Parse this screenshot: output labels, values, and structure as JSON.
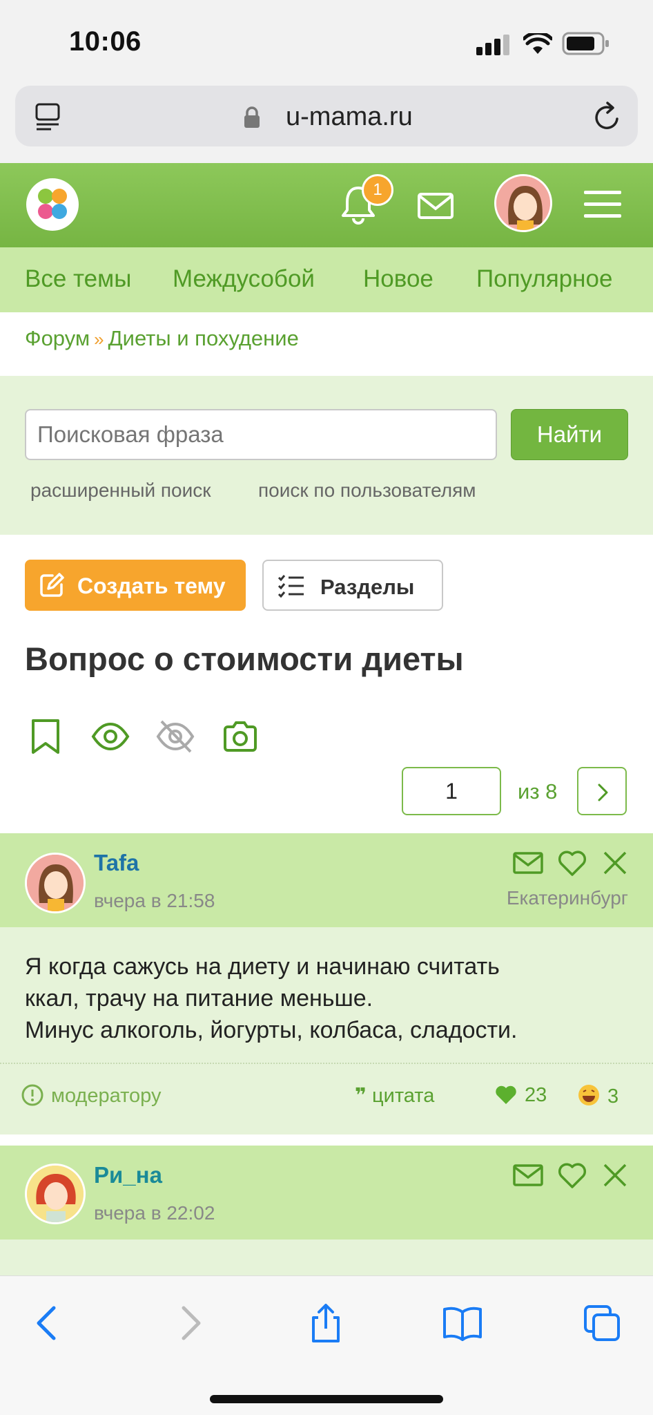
{
  "status": {
    "time": "10:06"
  },
  "browser": {
    "url": "u-mama.ru"
  },
  "header": {
    "notification_count": "1"
  },
  "nav": {
    "items": [
      "Все темы",
      "Междусобой",
      "Новое",
      "Популярное"
    ]
  },
  "breadcrumb": {
    "forum": "Форум",
    "section": "Диеты и похудение",
    "separator": "»"
  },
  "search": {
    "placeholder": "Поисковая фраза",
    "button": "Найти",
    "advanced": "расширенный поиск",
    "by_users": "поиск по пользователям"
  },
  "actions": {
    "create": "Создать тему",
    "sections": "Разделы"
  },
  "topic": {
    "title": "Вопрос о стоимости диеты"
  },
  "pager": {
    "current": "1",
    "of": "из 8"
  },
  "posts": [
    {
      "author": "Tafa",
      "time": "вчера в 21:58",
      "city": "Екатеринбург",
      "lines": [
        "Я когда сажусь на диету и начинаю считать",
        "ккал, трачу на питание меньше.",
        "Минус алкоголь, йогурты, колбаса, сладости."
      ],
      "moderator": "модератору",
      "quote": "цитата",
      "likes": "23",
      "laughs": "3"
    },
    {
      "author": "Ри_на",
      "time": "вчера в 22:02"
    }
  ],
  "colors": {
    "accent_green": "#76b543",
    "nav_bg": "#c9e9a6",
    "orange": "#f7a52d",
    "link_green": "#5aa131"
  }
}
